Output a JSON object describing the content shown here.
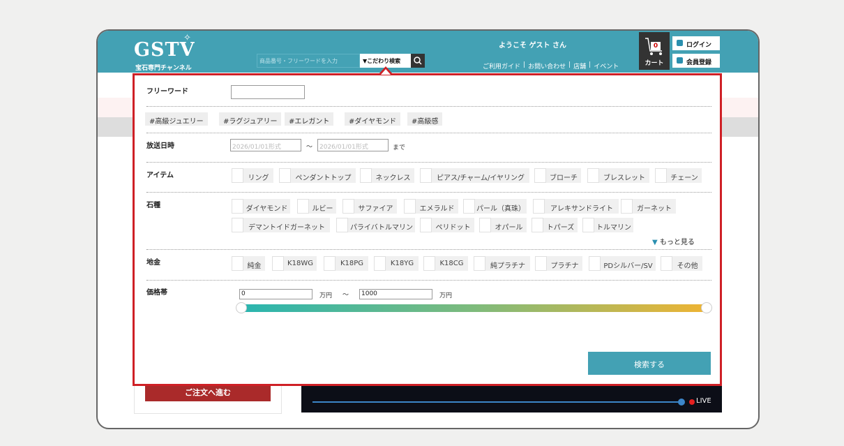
{
  "header": {
    "logo": "GSTV",
    "tagline": "宝石専門チャンネル",
    "search_placeholder": "商品番号・フリーワードを入力",
    "kodawari_label": "▼こだわり検索",
    "welcome": "ようこそ ゲスト さん",
    "links": [
      "ご利用ガイド",
      "|",
      "お問い合わせ",
      "|",
      "店舗",
      "|",
      "イベント"
    ],
    "cart_count": "0",
    "cart_label": "カート",
    "login_label": "ログイン",
    "register_label": "会員登録"
  },
  "panel": {
    "freeword_label": "フリーワード",
    "freeword_value": "",
    "tags": [
      "#高級ジュエリー",
      "#ラグジュアリー",
      "#エレガント",
      "#ダイヤモンド",
      "#高級感"
    ],
    "broadcast_label": "放送日時",
    "date_from_placeholder": "2026/01/01形式",
    "date_sep": "〜",
    "date_to_placeholder": "2026/01/01形式",
    "date_suffix": "まで",
    "item_label": "アイテム",
    "items": [
      "リング",
      "ペンダントトップ",
      "ネックレス",
      "ピアス/チャーム/イヤリング",
      "ブローチ",
      "ブレスレット",
      "チェーン"
    ],
    "stone_label": "石種",
    "stones_row1": [
      "ダイヤモンド",
      "ルビー",
      "サファイア",
      "エメラルド",
      "パール（真珠）",
      "アレキサンドライト",
      "ガーネット"
    ],
    "stones_row2": [
      "デマントイドガーネット",
      "パライバトルマリン",
      "ペリドット",
      "オパール",
      "トパーズ",
      "トルマリン"
    ],
    "more_label": "もっと見る",
    "metal_label": "地金",
    "metals": [
      "純金",
      "K18WG",
      "K18PG",
      "K18YG",
      "K18CG",
      "純プラチナ",
      "プラチナ",
      "PDシルバー/SV",
      "その他"
    ],
    "price_label": "価格帯",
    "price_min": "0",
    "price_max": "1000",
    "price_unit": "万円",
    "price_sep": "〜",
    "submit_label": "検索する"
  },
  "page": {
    "order_button": "ご注文へ進む",
    "live_label": "LIVE"
  }
}
